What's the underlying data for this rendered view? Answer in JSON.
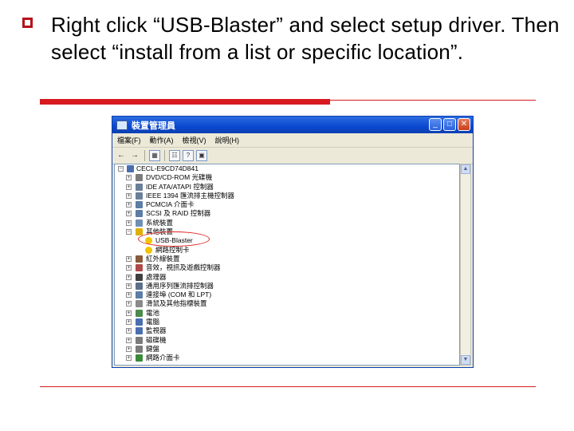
{
  "slide": {
    "text": "Right click “USB-Blaster” and select setup driver. Then select “install from a list or specific location”."
  },
  "colors": {
    "accent": "#d71920",
    "titlebar": "#0b48d1",
    "annotation": "#e02020"
  },
  "window": {
    "title": "裝置管理員",
    "buttons": {
      "minimize": "_",
      "maximize": "□",
      "close": "✕"
    },
    "menu": [
      "檔案(F)",
      "動作(A)",
      "檢視(V)",
      "說明(H)"
    ],
    "toolbar": {
      "back": "←",
      "forward": "→",
      "icons": [
        "view-icon",
        "properties-icon",
        "help-icon",
        "device-view-icon"
      ]
    },
    "scroll": {
      "up": "▲",
      "down": "▼"
    },
    "tree": {
      "root": "CECL-E9CD74D841",
      "items": [
        {
          "label": "DVD/CD-ROM 光碟機",
          "icon": "cdrom-icon",
          "color": "#7b7b7b",
          "level": 1,
          "expander": "+"
        },
        {
          "label": "IDE ATA/ATAPI 控制器",
          "icon": "ide-icon",
          "color": "#6a7f99",
          "level": 1,
          "expander": "+"
        },
        {
          "label": "IEEE 1394 匯流排主機控制器",
          "icon": "ieee1394-icon",
          "color": "#6a7f99",
          "level": 1,
          "expander": "+"
        },
        {
          "label": "PCMCIA 介面卡",
          "icon": "pcmcia-icon",
          "color": "#5b7da6",
          "level": 1,
          "expander": "+"
        },
        {
          "label": "SCSI 及 RAID 控制器",
          "icon": "scsi-icon",
          "color": "#5b7da6",
          "level": 1,
          "expander": "+"
        },
        {
          "label": "系統裝置",
          "icon": "system-device-icon",
          "color": "#6f8fb5",
          "level": 1,
          "expander": "+"
        },
        {
          "label": "其他裝置",
          "icon": "other-devices-icon",
          "color": "#e0b000",
          "level": 1,
          "expander": "−"
        },
        {
          "label": "USB-Blaster",
          "icon": "unknown-device-icon",
          "color": "#f3c400",
          "level": 2,
          "expander": ""
        },
        {
          "label": "網路控制卡",
          "icon": "unknown-device-icon",
          "color": "#f3c400",
          "level": 2,
          "expander": ""
        },
        {
          "label": "紅外線裝置",
          "icon": "infrared-icon",
          "color": "#8a5a3a",
          "level": 1,
          "expander": "+"
        },
        {
          "label": "音效，視訊及遊戲控制器",
          "icon": "sound-icon",
          "color": "#b04a4a",
          "level": 1,
          "expander": "+"
        },
        {
          "label": "處理器",
          "icon": "processor-icon",
          "color": "#404040",
          "level": 1,
          "expander": "+"
        },
        {
          "label": "通用序列匯流排控制器",
          "icon": "usb-icon",
          "color": "#5b6f8a",
          "level": 1,
          "expander": "+"
        },
        {
          "label": "連接埠 (COM 和 LPT)",
          "icon": "port-icon",
          "color": "#5b7da6",
          "level": 1,
          "expander": "+"
        },
        {
          "label": "滑鼠及其他指標裝置",
          "icon": "mouse-icon",
          "color": "#8a8a8a",
          "level": 1,
          "expander": "+"
        },
        {
          "label": "電池",
          "icon": "battery-icon",
          "color": "#4a8a4a",
          "level": 1,
          "expander": "+"
        },
        {
          "label": "電腦",
          "icon": "computer-icon",
          "color": "#4a6fb0",
          "level": 1,
          "expander": "+"
        },
        {
          "label": "監視器",
          "icon": "monitor-icon",
          "color": "#4a6fb0",
          "level": 1,
          "expander": "+"
        },
        {
          "label": "磁碟機",
          "icon": "disk-icon",
          "color": "#7b7b7b",
          "level": 1,
          "expander": "+"
        },
        {
          "label": "鍵盤",
          "icon": "keyboard-icon",
          "color": "#7b7b7b",
          "level": 1,
          "expander": "+"
        },
        {
          "label": "網路介面卡",
          "icon": "network-adapter-icon",
          "color": "#3a8a3a",
          "level": 1,
          "expander": "+"
        }
      ]
    }
  }
}
